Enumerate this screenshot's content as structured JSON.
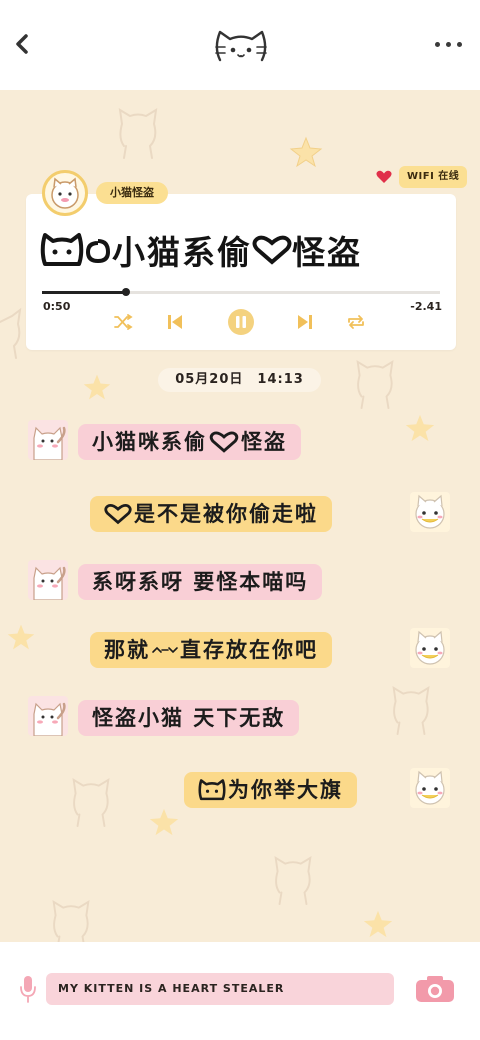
{
  "header": {
    "back_icon": "chevron-left-icon",
    "logo_icon": "cat-face-icon",
    "more_icon": "more-dots-icon"
  },
  "player": {
    "artist_tag": "小猫怪盗",
    "status_heart_color": "#e0304a",
    "status_label": "WIFI 在线",
    "song_title": "小猫系偷",
    "song_title_tail": "怪盗",
    "elapsed": "0:50",
    "remaining": "-2.41",
    "progress_fraction": 0.21,
    "controls": [
      "shuffle-icon",
      "previous-icon",
      "pause-icon",
      "next-icon",
      "repeat-icon"
    ],
    "accent": "#f1c05a"
  },
  "chat": {
    "date": "05月20日　14:13",
    "messages": [
      {
        "side": "left",
        "text_a": "小猫咪系偷",
        "text_b": "怪盗"
      },
      {
        "side": "right",
        "text_b": "是不是被你偷走啦"
      },
      {
        "side": "left",
        "text": "系呀系呀 要怪本喵吗"
      },
      {
        "side": "right",
        "text_a": "那就",
        "text_b": "直存放在你吧"
      },
      {
        "side": "left",
        "text": "怪盗小猫 天下无敌"
      },
      {
        "side": "right",
        "text_b": "为你举大旗"
      }
    ]
  },
  "composer": {
    "mic_icon": "microphone-icon",
    "input_value": "MY KITTEN IS A HEART STEALER",
    "camera_icon": "camera-icon"
  },
  "colors": {
    "background": "#f8ecd7",
    "pink_bubble": "#f9cfd6",
    "yellow_bubble": "#fbd98a"
  }
}
